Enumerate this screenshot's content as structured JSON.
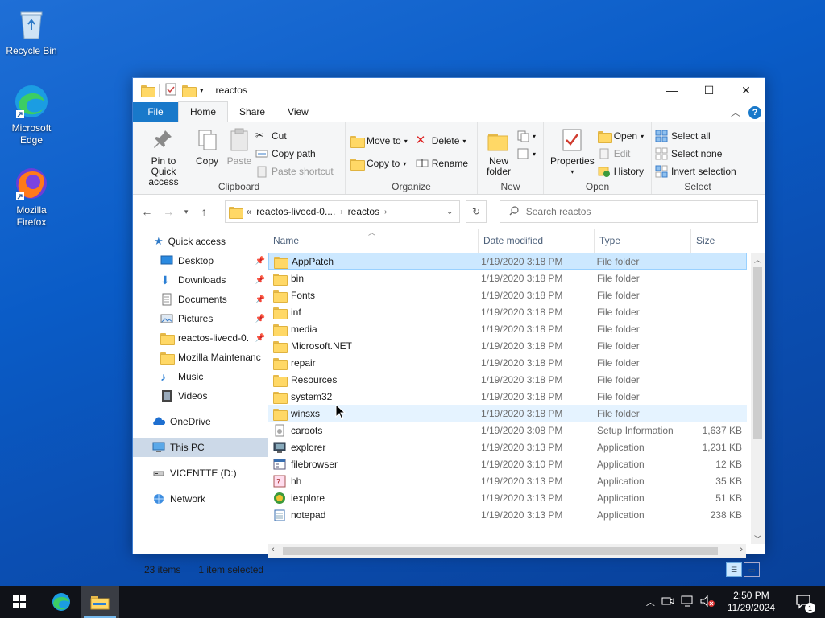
{
  "desktop": {
    "icons": [
      {
        "label": "Recycle Bin"
      },
      {
        "label": "Microsoft Edge"
      },
      {
        "label": "Mozilla Firefox"
      }
    ]
  },
  "window": {
    "title": "reactos",
    "tabs": {
      "file": "File",
      "home": "Home",
      "share": "Share",
      "view": "View"
    },
    "help": "?"
  },
  "ribbon": {
    "clipboard": {
      "label": "Clipboard",
      "pin": "Pin to Quick access",
      "copy": "Copy",
      "paste": "Paste",
      "cut": "Cut",
      "copy_path": "Copy path",
      "paste_shortcut": "Paste shortcut"
    },
    "organize": {
      "label": "Organize",
      "move_to": "Move to",
      "copy_to": "Copy to",
      "delete": "Delete",
      "rename": "Rename"
    },
    "new": {
      "label": "New",
      "new_folder": "New folder"
    },
    "open": {
      "label": "Open",
      "properties": "Properties",
      "open": "Open",
      "edit": "Edit",
      "history": "History"
    },
    "select": {
      "label": "Select",
      "select_all": "Select all",
      "select_none": "Select none",
      "invert": "Invert selection"
    }
  },
  "address": {
    "overflow": "«",
    "crumbs": [
      "reactos-livecd-0....",
      "reactos"
    ],
    "search_placeholder": "Search reactos"
  },
  "nav": {
    "quick_access": "Quick access",
    "items": [
      {
        "label": "Desktop",
        "pinned": true
      },
      {
        "label": "Downloads",
        "pinned": true
      },
      {
        "label": "Documents",
        "pinned": true
      },
      {
        "label": "Pictures",
        "pinned": true
      },
      {
        "label": "reactos-livecd-0.",
        "pinned": true
      },
      {
        "label": "Mozilla Maintenanc",
        "pinned": false
      },
      {
        "label": "Music",
        "pinned": false
      },
      {
        "label": "Videos",
        "pinned": false
      }
    ],
    "onedrive": "OneDrive",
    "this_pc": "This PC",
    "drive": "VICENTTE (D:)",
    "network": "Network"
  },
  "columns": {
    "name": "Name",
    "date": "Date modified",
    "type": "Type",
    "size": "Size"
  },
  "files": [
    {
      "name": "AppPatch",
      "date": "1/19/2020 3:18 PM",
      "type": "File folder",
      "size": "",
      "icon": "folder-icon"
    },
    {
      "name": "bin",
      "date": "1/19/2020 3:18 PM",
      "type": "File folder",
      "size": "",
      "icon": "folder-icon"
    },
    {
      "name": "Fonts",
      "date": "1/19/2020 3:18 PM",
      "type": "File folder",
      "size": "",
      "icon": "folder-icon"
    },
    {
      "name": "inf",
      "date": "1/19/2020 3:18 PM",
      "type": "File folder",
      "size": "",
      "icon": "folder-icon"
    },
    {
      "name": "media",
      "date": "1/19/2020 3:18 PM",
      "type": "File folder",
      "size": "",
      "icon": "folder-icon"
    },
    {
      "name": "Microsoft.NET",
      "date": "1/19/2020 3:18 PM",
      "type": "File folder",
      "size": "",
      "icon": "folder-icon"
    },
    {
      "name": "repair",
      "date": "1/19/2020 3:18 PM",
      "type": "File folder",
      "size": "",
      "icon": "folder-icon"
    },
    {
      "name": "Resources",
      "date": "1/19/2020 3:18 PM",
      "type": "File folder",
      "size": "",
      "icon": "folder-icon"
    },
    {
      "name": "system32",
      "date": "1/19/2020 3:18 PM",
      "type": "File folder",
      "size": "",
      "icon": "folder-icon"
    },
    {
      "name": "winsxs",
      "date": "1/19/2020 3:18 PM",
      "type": "File folder",
      "size": "",
      "icon": "folder-icon"
    },
    {
      "name": "caroots",
      "date": "1/19/2020 3:08 PM",
      "type": "Setup Information",
      "size": "1,637 KB",
      "icon": "setup-info-icon"
    },
    {
      "name": "explorer",
      "date": "1/19/2020 3:13 PM",
      "type": "Application",
      "size": "1,231 KB",
      "icon": "explorer-app-icon"
    },
    {
      "name": "filebrowser",
      "date": "1/19/2020 3:10 PM",
      "type": "Application",
      "size": "12 KB",
      "icon": "filebrowser-app-icon"
    },
    {
      "name": "hh",
      "date": "1/19/2020 3:13 PM",
      "type": "Application",
      "size": "35 KB",
      "icon": "help-app-icon"
    },
    {
      "name": "iexplore",
      "date": "1/19/2020 3:13 PM",
      "type": "Application",
      "size": "51 KB",
      "icon": "iexplore-app-icon"
    },
    {
      "name": "notepad",
      "date": "1/19/2020 3:13 PM",
      "type": "Application",
      "size": "238 KB",
      "icon": "notepad-app-icon"
    }
  ],
  "status": {
    "count": "23 items",
    "selected": "1 item selected"
  },
  "taskbar": {
    "time": "2:50 PM",
    "date": "11/29/2024",
    "notifications": "1"
  }
}
